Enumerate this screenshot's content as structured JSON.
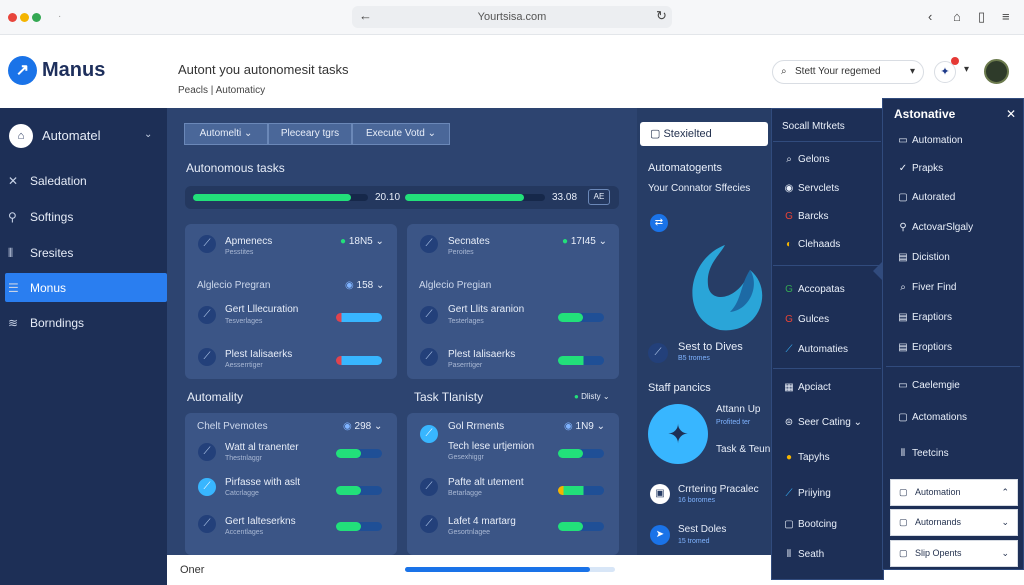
{
  "browser": {
    "url": "Yourtsisa.com"
  },
  "header": {
    "brand": "Manus",
    "subtitle": "Autont you autonomesit tasks",
    "breadcrumb_a": "Peacls",
    "breadcrumb_sep": "|",
    "breadcrumb_b": "Automaticy",
    "search_placeholder": "Stett Your regemed"
  },
  "sidebar": {
    "items": [
      {
        "label": "Automatel",
        "icon": "dashboard-icon"
      },
      {
        "label": "Saledation",
        "icon": "tools-icon"
      },
      {
        "label": "Softings",
        "icon": "wrench-icon"
      },
      {
        "label": "Sresites",
        "icon": "layers-icon"
      },
      {
        "label": "Monus",
        "icon": "menu-icon"
      },
      {
        "label": "Borndings",
        "icon": "stack-icon"
      }
    ]
  },
  "main": {
    "tabs": [
      "Automelti",
      "Pleceary tgrs",
      "Execute Votd"
    ],
    "autonomous_title": "Autonomous tasks",
    "progress": {
      "a_label": "20.10",
      "b_label": "33.08",
      "btn": "AE",
      "a": 0.9,
      "b": 0.85
    },
    "card1": {
      "title": "Apmenecs",
      "sub": "Pesstites",
      "badge": "18N5",
      "section": "Alglecio Pregran",
      "section_badge": "158",
      "rows": [
        {
          "title": "Gert Lllecuration",
          "sub": "Tesverlages"
        },
        {
          "title": "Plest Ialisaerks",
          "sub": "Aesserrtiger"
        }
      ]
    },
    "card2": {
      "title": "Secnates",
      "sub": "Peroites",
      "badge": "17I45",
      "section": "Alglecio Pregian",
      "rows": [
        {
          "title": "Gert Llits aranion",
          "sub": "Testerlages"
        },
        {
          "title": "Plest Ialisaerks",
          "sub": "Paserrtiger"
        }
      ]
    },
    "automality_title": "Automality",
    "task_title": "Task Tlanisty",
    "task_badge": "Dlisty",
    "card3": {
      "section": "Chelt Pvemotes",
      "badge": "298",
      "rows": [
        {
          "title": "Watt al tranenter",
          "sub": "Thestnlaggr"
        },
        {
          "title": "Pirfasse with aslt",
          "sub": "Catcrlagge"
        },
        {
          "title": "Gert Ialteserkns",
          "sub": "Accentlages"
        }
      ]
    },
    "card4": {
      "section": "Gol Rrments",
      "badge": "1N9",
      "rows": [
        {
          "title": "Tech lese urtjemion",
          "sub": "Gesexhiggr"
        },
        {
          "title": "Pafte alt utement",
          "sub": "Betarlagge"
        },
        {
          "title": "Lafet 4 martarg",
          "sub": "Gesortnlagee"
        }
      ]
    },
    "bottom_label": "Oner"
  },
  "right": {
    "selected": "Stexielted",
    "heading": "Automatogents",
    "subheading": "Your Connator Sffecies",
    "sent_title": "Sest to Dives",
    "sent_sub": "B5 tromes",
    "staff": "Staff pancics",
    "attn": "Attann Up",
    "attn_sub": "Profited ter",
    "task_team": "Task & Teun",
    "event": "Crrtering Pracalec",
    "event_sub": "16 boromes",
    "sales": "Sest Doles",
    "sales_sub": "15 tromed"
  },
  "menu1": {
    "title": "Socall Mtrkets",
    "items": [
      "Gelons",
      "Servclets",
      "Barcks",
      "Clehaads",
      "Accopatas",
      "Gulces",
      "Automaties",
      "Apciact",
      "Seer Cating",
      "Tapyhs",
      "Priiying",
      "Bootcing",
      "Seath"
    ]
  },
  "menu2": {
    "title": "Astonative",
    "items": [
      "Automation",
      "Prapks",
      "Autorated",
      "ActovarSlgaly",
      "Dicistion",
      "Fiver Find",
      "Eraptiors",
      "Eroptiors",
      "Caelemgie",
      "Actomations",
      "Teetcins"
    ],
    "cards": [
      "Automation",
      "Autornands",
      "Slip Opents"
    ]
  }
}
